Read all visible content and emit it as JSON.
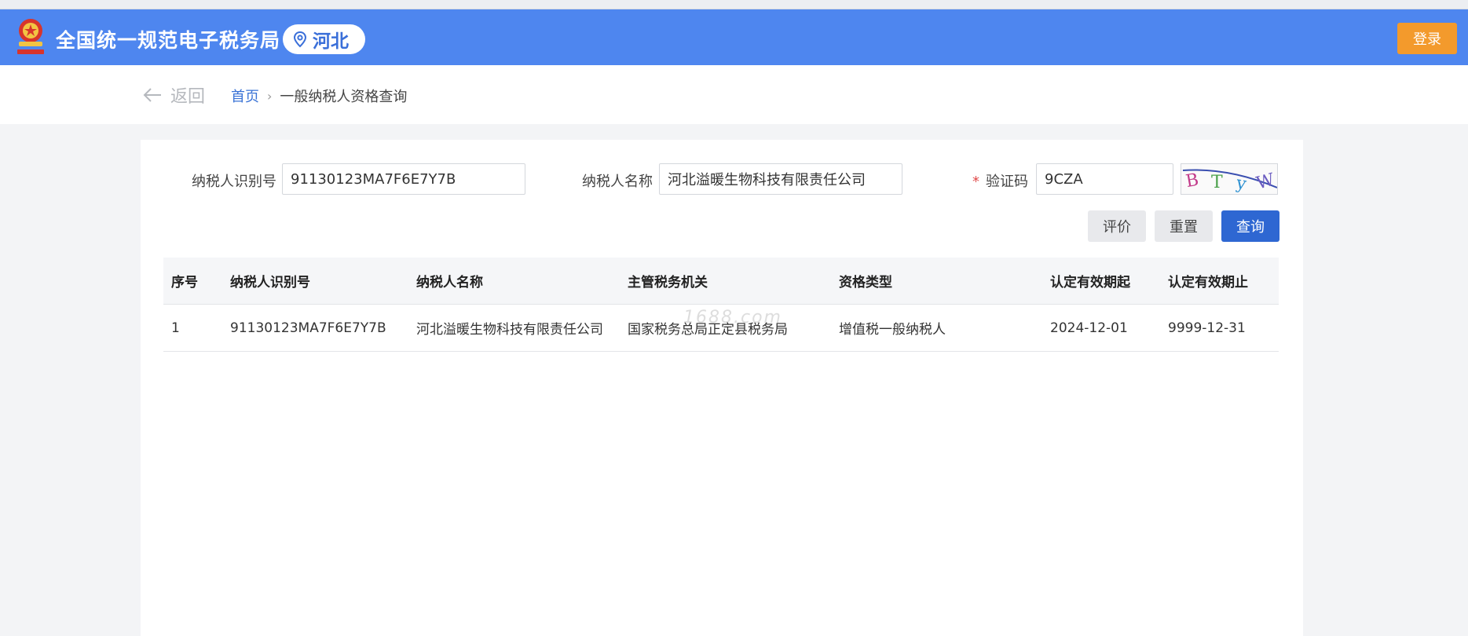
{
  "header": {
    "site_title": "全国统一规范电子税务局",
    "region": "河北",
    "login_label": "登录"
  },
  "nav": {
    "back_label": "返回",
    "breadcrumb_home": "首页",
    "breadcrumb_separator": "›",
    "breadcrumb_current": "一般纳税人资格查询"
  },
  "form": {
    "taxpayer_id_label": "纳税人识别号",
    "taxpayer_id_value": "91130123MA7F6E7Y7B",
    "taxpayer_name_label": "纳税人名称",
    "taxpayer_name_value": "河北溢暖生物科技有限责任公司",
    "captcha_required_mark": "*",
    "captcha_label": "验证码",
    "captcha_value": "9CZA",
    "captcha_image_text": "BTyW"
  },
  "buttons": {
    "evaluate": "评价",
    "reset": "重置",
    "query": "查询"
  },
  "table": {
    "headers": [
      "序号",
      "纳税人识别号",
      "纳税人名称",
      "主管税务机关",
      "资格类型",
      "认定有效期起",
      "认定有效期止"
    ],
    "rows": [
      [
        "1",
        "91130123MA7F6E7Y7B",
        "河北溢暖生物科技有限责任公司",
        "国家税务总局正定县税务局",
        "增值税一般纳税人",
        "2024-12-01",
        "9999-12-31"
      ]
    ]
  },
  "watermark": "1688.com",
  "colors": {
    "header_bg": "#4e86ef",
    "login_bg": "#f39a2c",
    "query_bg": "#2e67d2",
    "link": "#3a73d6",
    "required": "#e04a4a"
  }
}
